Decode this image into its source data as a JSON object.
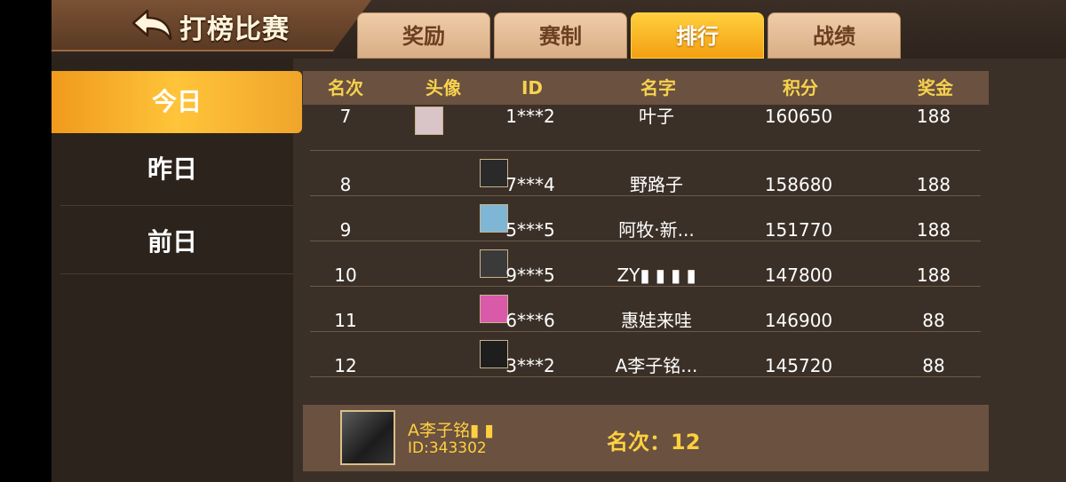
{
  "header": {
    "title": "打榜比赛",
    "tabs": [
      {
        "label": "奖励",
        "active": false
      },
      {
        "label": "赛制",
        "active": false
      },
      {
        "label": "排行",
        "active": true
      },
      {
        "label": "战绩",
        "active": false
      }
    ]
  },
  "sidebar": {
    "items": [
      {
        "label": "今日",
        "active": true
      },
      {
        "label": "昨日",
        "active": false
      },
      {
        "label": "前日",
        "active": false
      }
    ]
  },
  "table": {
    "columns": [
      "名次",
      "头像",
      "ID",
      "名字",
      "积分",
      "奖金"
    ],
    "rows": [
      {
        "rank": "7",
        "id": "1***2",
        "name": "叶子",
        "score": "160650",
        "prize": "188",
        "avatar_color": "#d9c4c8"
      },
      {
        "rank": "8",
        "id": "7***4",
        "name": "野路子",
        "score": "158680",
        "prize": "188",
        "avatar_color": "#2a2a2a"
      },
      {
        "rank": "9",
        "id": "5***5",
        "name": "阿牧·新...",
        "score": "151770",
        "prize": "188",
        "avatar_color": "#7fb6d6"
      },
      {
        "rank": "10",
        "id": "9***5",
        "name": "ZY▮ ▮ ▮ ▮",
        "score": "147800",
        "prize": "188",
        "avatar_color": "#3a3a3a"
      },
      {
        "rank": "11",
        "id": "6***6",
        "name": "惠娃来哇",
        "score": "146900",
        "prize": "88",
        "avatar_color": "#d85aa8"
      },
      {
        "rank": "12",
        "id": "3***2",
        "name": "A李子铭...",
        "score": "145720",
        "prize": "88",
        "avatar_color": "#1e1e1e"
      }
    ]
  },
  "me": {
    "name": "A李子铭▮ ▮",
    "id_text": "ID:343302",
    "rank_text": "名次：12"
  },
  "colors": {
    "accent": "#ffd040",
    "tab_active": "#f4a012",
    "panel": "#6a5140",
    "background": "#3b3027"
  }
}
